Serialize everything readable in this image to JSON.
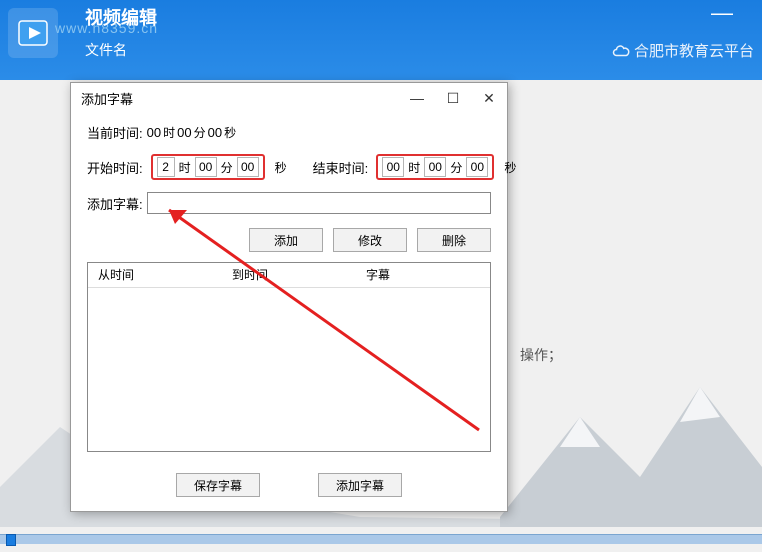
{
  "header": {
    "title": "视频编辑",
    "filename_label": "文件名",
    "watermark": "www.h8359.cn",
    "right_text": "合肥市教育云平台"
  },
  "side_text": "操作；",
  "dialog": {
    "title": "添加字幕",
    "minimize": "—",
    "maximize": "☐",
    "close": "✕",
    "current_time_label": "当前时间:",
    "current_h": "00",
    "current_m": "00",
    "current_s": "00",
    "unit_h": "时",
    "unit_m": "分",
    "unit_s": "秒",
    "start_label": "开始时间:",
    "start_h": "2",
    "start_m": "00",
    "start_s": "00",
    "end_label": "结束时间:",
    "end_h": "00",
    "end_m": "00",
    "end_s": "00",
    "subtitle_label": "添加字幕:",
    "subtitle_value": "",
    "btn_add": "添加",
    "btn_modify": "修改",
    "btn_delete": "删除",
    "col_from": "从时间",
    "col_to": "到时间",
    "col_sub": "字幕",
    "btn_save": "保存字幕",
    "btn_addsub": "添加字幕"
  }
}
